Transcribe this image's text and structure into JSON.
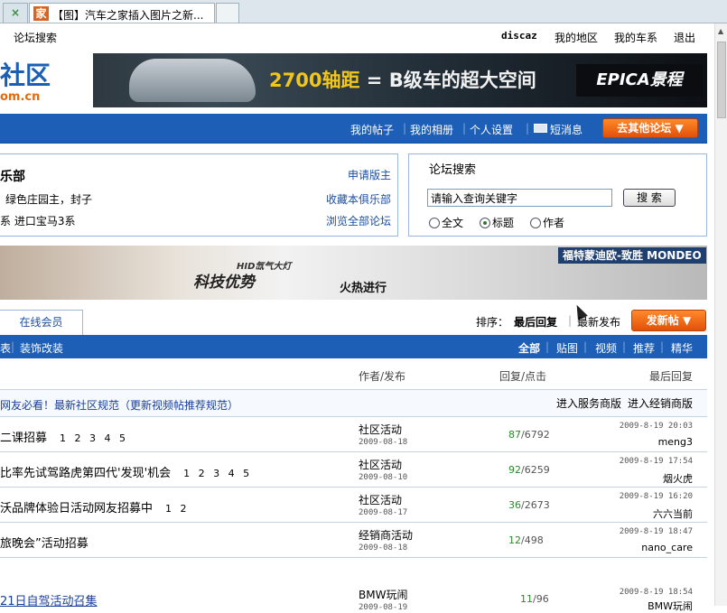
{
  "browser": {
    "tab_close_glyph": "×",
    "favicon_char": "家",
    "tab_title": "【图】汽车之家插入图片之新..."
  },
  "toplinks": {
    "left": "论坛搜索",
    "user": "discaz",
    "my_region": "我的地区",
    "my_car": "我的车系",
    "logout": "退出"
  },
  "logo": {
    "text": "社区",
    "sub": "om.cn"
  },
  "banner_ad": {
    "wheelbase": "2700轴距",
    "eq": "=",
    "slogan": "B级车的超大空间",
    "brand": "EPICA景程"
  },
  "navbar": {
    "my_posts": "我的帖子",
    "my_album": "我的相册",
    "settings": "个人设置",
    "messages": "短消息",
    "other_forums": "去其他论坛 ▼"
  },
  "club": {
    "name": "乐部",
    "moderators": "绿色庄园主，封子",
    "series": "系  进口宝马3系",
    "apply_moderator": "申请版主",
    "favorite": "收藏本俱乐部",
    "browse_all": "浏览全部论坛"
  },
  "search": {
    "heading": "论坛搜索",
    "placeholder": "请输入查询关键字",
    "button": "搜 索",
    "options": [
      "全文",
      "标题",
      "作者"
    ],
    "selected": "标题"
  },
  "ad2": {
    "tag": "HID氙气大灯",
    "headline": "科技优势",
    "hot": "火热进行",
    "brand": "福特蒙迪欧-致胜 MONDEO"
  },
  "tabs": {
    "online": "在线会员",
    "sort_label": "排序：",
    "sort_last_reply": "最后回复",
    "sort_new_post": "最新发布",
    "new_post_btn": "发新帖 ▼"
  },
  "filterbar": {
    "left_partial": "表",
    "decor": "装饰改装",
    "all": "全部",
    "image": "贴图",
    "video": "视频",
    "recommend": "推荐",
    "elite": "精华"
  },
  "columns": {
    "author": "作者/发布",
    "reply_view": "回复/点击",
    "last_reply": "最后回复"
  },
  "notice": {
    "text": "网友必看！最新社区规范（更新视频帖推荐规范）",
    "service": "进入服务商版",
    "dealer": "进入经销商版"
  },
  "threads": [
    {
      "title": "二课招募",
      "pages": "1 2 3 4 5",
      "category": "社区活动",
      "date": "2009-08-18",
      "replies": "87",
      "views": "/6792",
      "last_time": "2009-8-19 20:03",
      "last_by": "meng3"
    },
    {
      "title": "比率先试驾路虎第四代'发现'机会",
      "pages": "1 2 3 4 5",
      "category": "社区活动",
      "date": "2009-08-10",
      "replies": "92",
      "views": "/6259",
      "last_time": "2009-8-19 17:54",
      "last_by": "烟火虎"
    },
    {
      "title": "沃品牌体验日活动网友招募中",
      "pages": "1 2",
      "category": "社区活动",
      "date": "2009-08-17",
      "replies": "36",
      "views": "/2673",
      "last_time": "2009-8-19 16:20",
      "last_by": "六六当前"
    },
    {
      "title": "旅晚会”活动招募",
      "pages": "",
      "category": "经销商活动",
      "date": "2009-08-18",
      "replies": "12",
      "views": "/498",
      "last_time": "2009-8-19 18:47",
      "last_by": "nano_care"
    },
    {
      "title": "21日自驾活动召集",
      "pages": "",
      "category": "BMW玩闹",
      "date": "2009-08-19",
      "replies": "11",
      "views": "/96",
      "last_time": "2009-8-19 18:54",
      "last_by": "BMW玩闹"
    }
  ]
}
